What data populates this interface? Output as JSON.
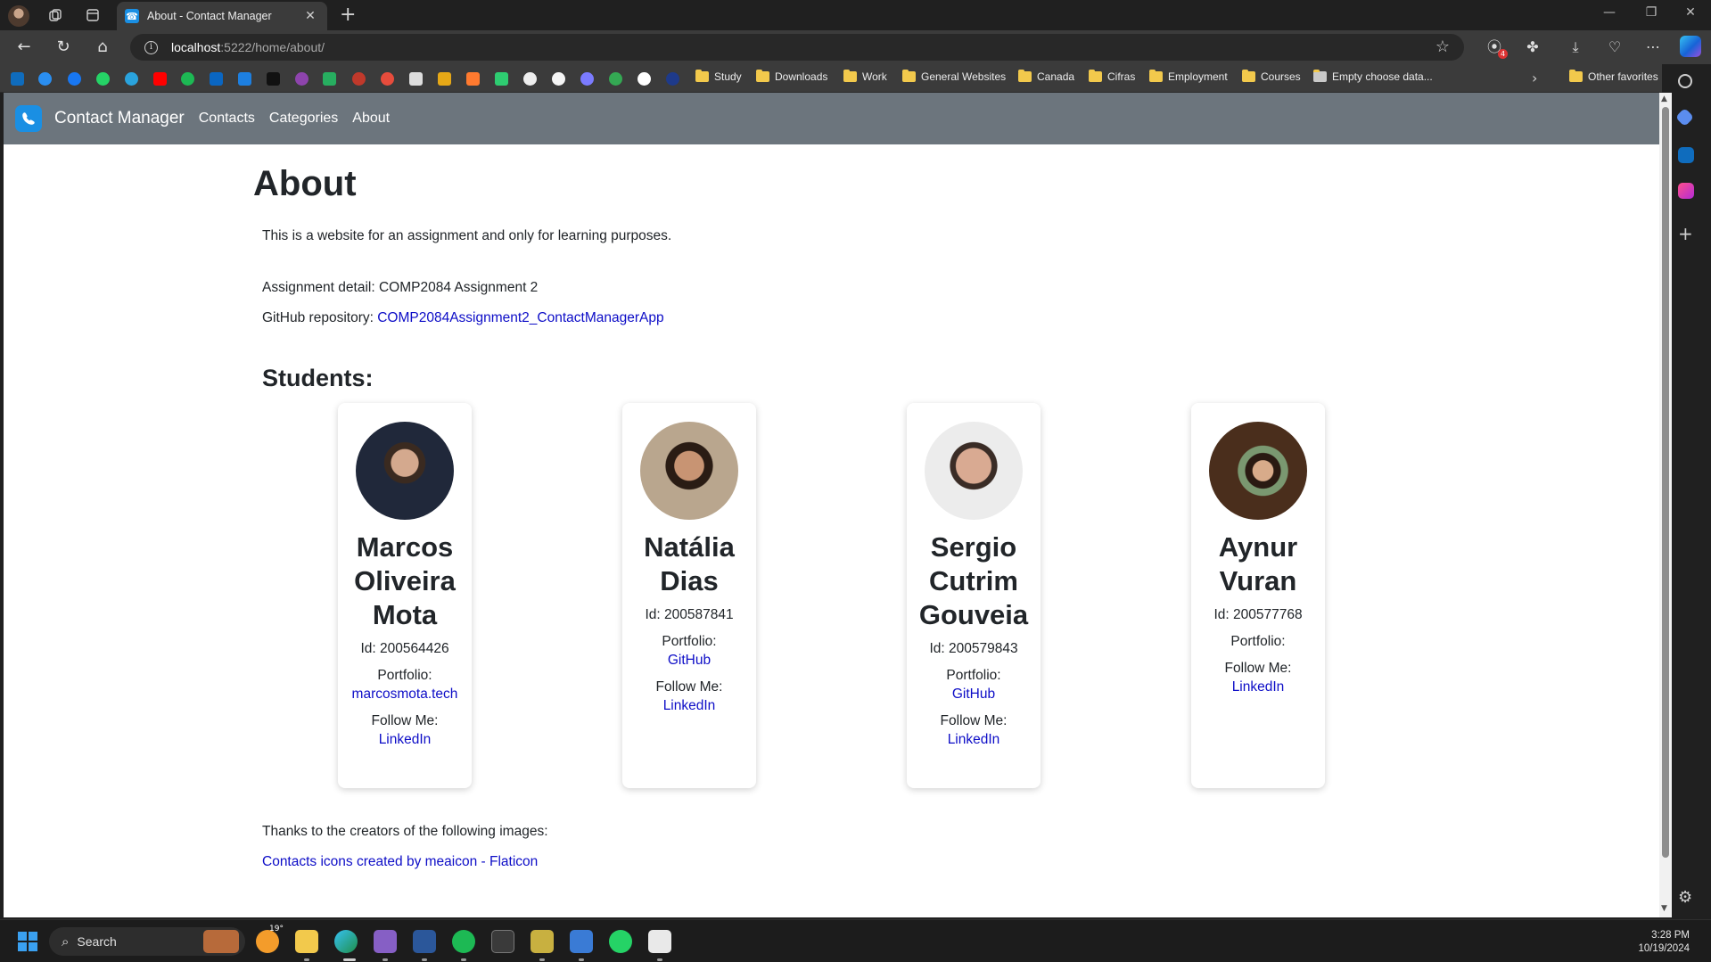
{
  "browser": {
    "tab_title": "About - Contact Manager",
    "url_host": "localhost",
    "url_path": ":5222/home/about/",
    "extension_badge": "4",
    "bookmarks": [
      {
        "label": "Study"
      },
      {
        "label": "Downloads"
      },
      {
        "label": "Work"
      },
      {
        "label": "General Websites"
      },
      {
        "label": "Canada"
      },
      {
        "label": "Cifras"
      },
      {
        "label": "Employment"
      },
      {
        "label": "Courses"
      },
      {
        "label": "Empty choose data..."
      }
    ],
    "other_favorites": "Other favorites"
  },
  "site": {
    "brand": "Contact Manager",
    "nav": [
      "Contacts",
      "Categories",
      "About"
    ],
    "brand_color": "#1a8fe3",
    "navbar_color": "#6c757d"
  },
  "page": {
    "title": "About",
    "intro": "This is a website for an assignment and only for learning purposes.",
    "assignment_label": "Assignment detail: COMP2084 Assignment 2",
    "github_label": "GitHub repository: ",
    "github_link": "COMP2084Assignment2_ContactManagerApp",
    "students_heading": "Students:",
    "students": [
      {
        "name": "Marcos Oliveira Mota",
        "id": "Id: 200564426",
        "portfolio_label": "Portfolio:",
        "portfolio_link": "marcosmota.tech",
        "follow_label": "Follow Me:",
        "follow_link": "LinkedIn"
      },
      {
        "name": "Natália Dias",
        "id": "Id: 200587841",
        "portfolio_label": "Portfolio:",
        "portfolio_link": "GitHub",
        "follow_label": "Follow Me:",
        "follow_link": "LinkedIn"
      },
      {
        "name": "Sergio Cutrim Gouveia",
        "id": "Id: 200579843",
        "portfolio_label": "Portfolio:",
        "portfolio_link": "GitHub",
        "follow_label": "Follow Me:",
        "follow_link": "LinkedIn"
      },
      {
        "name": "Aynur Vuran",
        "id": "Id: 200577768",
        "portfolio_label": "Portfolio:",
        "portfolio_link": "",
        "follow_label": "Follow Me:",
        "follow_link": "LinkedIn"
      }
    ],
    "thanks": "Thanks to the creators of the following images:",
    "credit_link": "Contacts icons created by meaicon - Flaticon"
  },
  "taskbar": {
    "search": "Search",
    "weather_temp": "19°",
    "time": "3:28 PM",
    "date": "10/19/2024"
  }
}
